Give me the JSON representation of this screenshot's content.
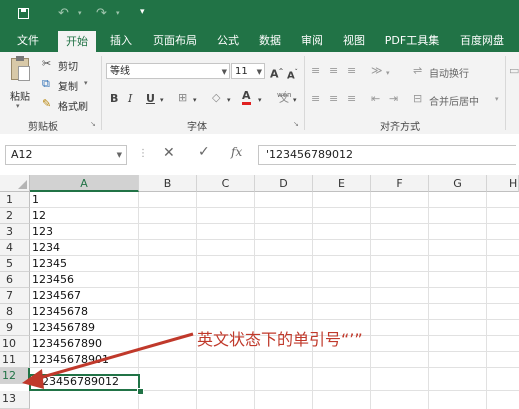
{
  "qat": {
    "save_icon": "save-icon",
    "undo_icon": "undo-icon",
    "redo_icon": "redo-icon",
    "customize_icon": "customize-icon"
  },
  "tabs": [
    "文件",
    "开始",
    "插入",
    "页面布局",
    "公式",
    "数据",
    "审阅",
    "视图",
    "PDF工具集",
    "百度网盘"
  ],
  "active_tab": "开始",
  "clipboard": {
    "paste": "粘贴",
    "cut": "剪切",
    "copy": "复制",
    "format_painter": "格式刷",
    "group": "剪贴板"
  },
  "font": {
    "name": "等线",
    "size": "11",
    "grow": "A",
    "shrink": "A",
    "bold": "B",
    "italic": "I",
    "underline": "U",
    "font_color_letter": "A",
    "wen": "wén",
    "group": "字体"
  },
  "alignment": {
    "wrap_text": "自动换行",
    "merge_center": "合并后居中",
    "group": "对齐方式"
  },
  "formula_bar": {
    "name_box": "A12",
    "fx": "fx",
    "content": "'123456789012"
  },
  "columns": [
    "A",
    "B",
    "C",
    "D",
    "E",
    "F",
    "G",
    "H"
  ],
  "rows": [
    {
      "num": "1",
      "a": "1"
    },
    {
      "num": "2",
      "a": "12"
    },
    {
      "num": "3",
      "a": "123"
    },
    {
      "num": "4",
      "a": "1234"
    },
    {
      "num": "5",
      "a": "12345"
    },
    {
      "num": "6",
      "a": "123456"
    },
    {
      "num": "7",
      "a": "1234567"
    },
    {
      "num": "8",
      "a": "12345678"
    },
    {
      "num": "9",
      "a": "123456789"
    },
    {
      "num": "10",
      "a": "1234567890"
    },
    {
      "num": "11",
      "a": "12345678901"
    },
    {
      "num": "12",
      "a": "'123456789012"
    },
    {
      "num": "13",
      "a": ""
    }
  ],
  "selected_cell": "A12",
  "annotation": "英文状态下的单引号“’”",
  "colors": {
    "brand": "#217346",
    "annotation": "#c0392b"
  }
}
